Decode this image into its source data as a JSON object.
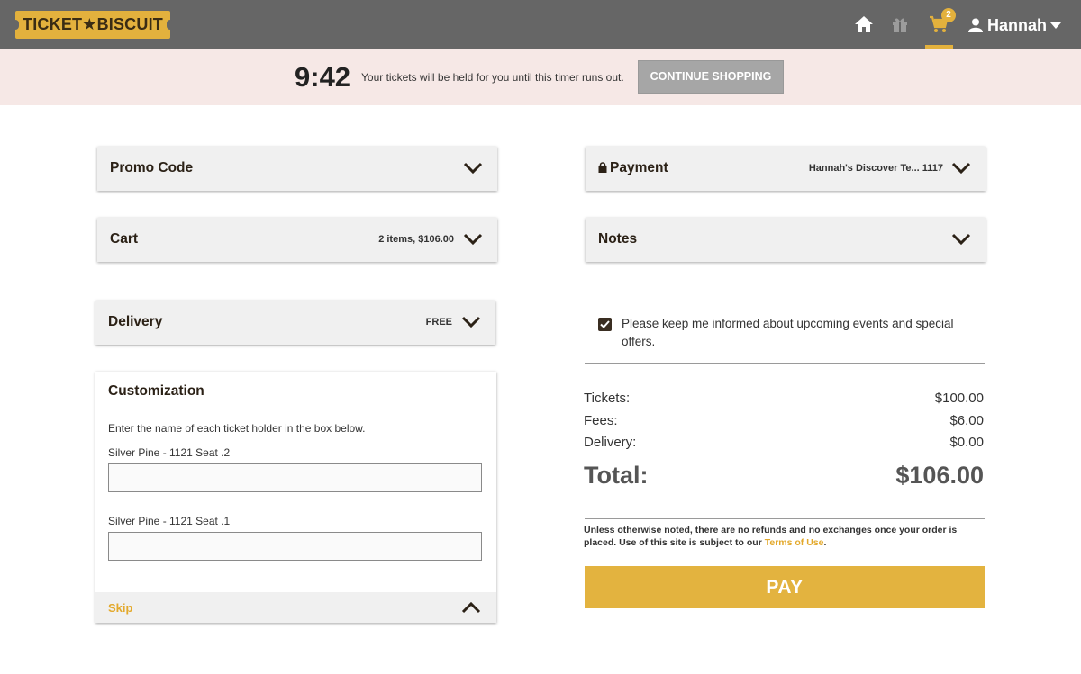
{
  "header": {
    "logo_text": "TICKET★BISCUIT",
    "cart_count": "2",
    "user_name": "Hannah",
    "icons": [
      "home-icon",
      "gift-icon",
      "cart-icon",
      "user-icon"
    ],
    "brand_color": "#e3b13d"
  },
  "timer": {
    "time": "9:42",
    "message": "Your tickets will be held for you until this timer runs out.",
    "continue_label": "CONTINUE SHOPPING"
  },
  "left": {
    "promo": {
      "title": "Promo Code"
    },
    "cart": {
      "title": "Cart",
      "summary": "2 items, $106.00"
    },
    "delivery": {
      "title": "Delivery",
      "summary": "FREE"
    },
    "customization": {
      "title": "Customization",
      "instructions": "Enter the name of each ticket holder in the box below.",
      "fields": [
        {
          "label": "Silver Pine - 1121 Seat .2",
          "value": ""
        },
        {
          "label": "Silver Pine - 1121 Seat .1",
          "value": ""
        }
      ],
      "skip_label": "Skip"
    }
  },
  "right": {
    "payment": {
      "title": "Payment",
      "summary": "Hannah's Discover Te... 1117"
    },
    "notes": {
      "title": "Notes"
    },
    "optin": {
      "checked": true,
      "text": "Please keep me informed about upcoming events and special offers."
    },
    "summary": {
      "tickets_label": "Tickets:",
      "tickets_value": "$100.00",
      "fees_label": "Fees:",
      "fees_value": "$6.00",
      "delivery_label": "Delivery:",
      "delivery_value": "$0.00",
      "total_label": "Total:",
      "total_value": "$106.00"
    },
    "legal": {
      "text": "Unless otherwise noted, there are no refunds and no exchanges once your order is placed. Use of this site is subject to our",
      "terms_link": "Terms of Use",
      "period": "."
    },
    "pay_label": "PAY"
  }
}
